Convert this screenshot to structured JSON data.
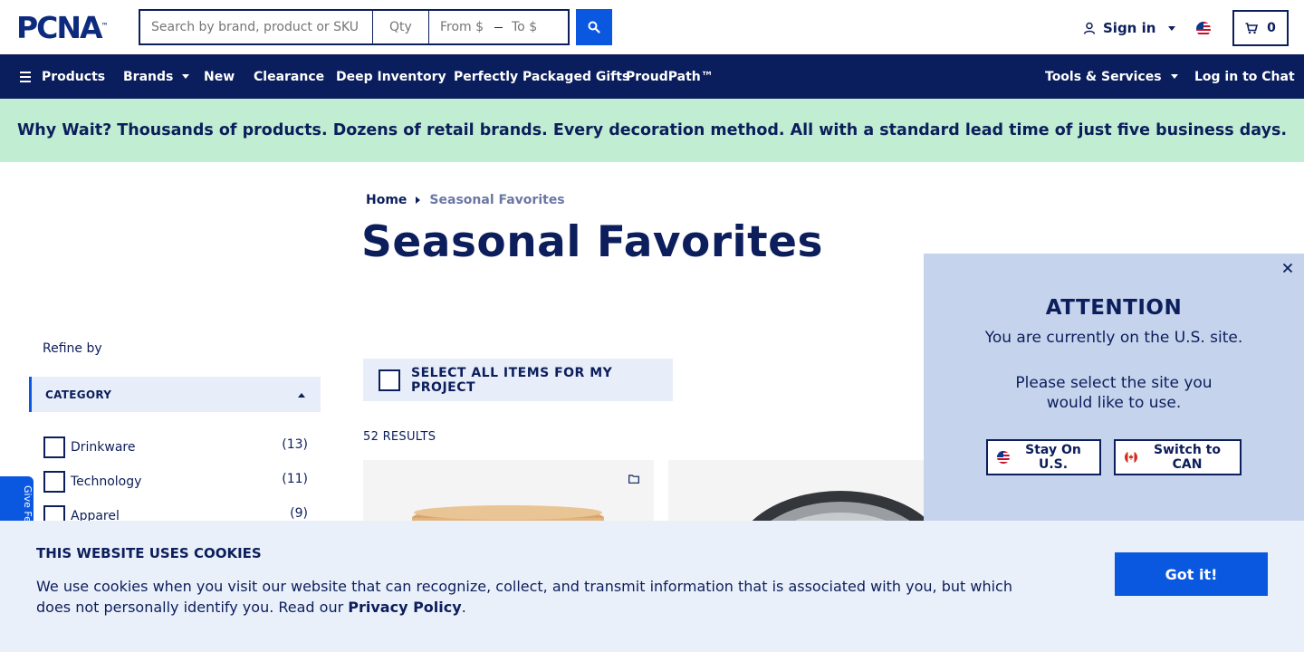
{
  "header": {
    "logo_text": "PCNA",
    "logo_tm": "™",
    "search_placeholder": "Search by brand, product or SKU",
    "qty_placeholder": "Qty",
    "price_from_placeholder": "From $",
    "price_to_placeholder": "To $",
    "signin_label": "Sign in",
    "cart_count": "0"
  },
  "nav": {
    "products": "Products",
    "brands": "Brands",
    "new": "New",
    "clearance": "Clearance",
    "deep_inventory": "Deep Inventory",
    "gifts": "Perfectly Packaged Gifts",
    "proudpath": "ProudPath™",
    "tools": "Tools & Services",
    "chat": "Log in to Chat"
  },
  "promo": {
    "text": "Why Wait? Thousands of products. Dozens of retail brands. Every decoration method. All with a standard lead time of just five business days."
  },
  "breadcrumb": {
    "home": "Home",
    "current": "Seasonal Favorites"
  },
  "page_title": "Seasonal Favorites",
  "sidebar": {
    "refine_label": "Refine by",
    "category_header": "CATEGORY",
    "categories": [
      {
        "label": "Drinkware",
        "count": "(13)"
      },
      {
        "label": "Technology",
        "count": "(11)"
      },
      {
        "label": "Apparel",
        "count": "(9)"
      }
    ]
  },
  "feedback_label": "Give Feedback",
  "listing": {
    "select_all": "SELECT ALL ITEMS FOR MY PROJECT",
    "results": "52 RESULTS"
  },
  "popup": {
    "title": "ATTENTION",
    "current_site": "You are currently on the U.S. site.",
    "select_prompt": "Please select the site you would like to use.",
    "stay_button": "Stay On U.S.",
    "switch_button": "Switch to CAN"
  },
  "cookie": {
    "heading": "THIS WEBSITE USES COOKIES",
    "body": "We use cookies when you visit our website that can recognize, collect, and transmit information that is associated with you, but which does not personally identify you. Read our",
    "policy_link": "Privacy Policy",
    "period": ".",
    "button": "Got it!"
  },
  "colors": {
    "navy": "#0a1d5c",
    "accent_blue": "#0b58e0",
    "promo_green": "#c1eed2",
    "popup_blue": "#c5d3ec",
    "cookie_bg": "#eaf0fa"
  }
}
